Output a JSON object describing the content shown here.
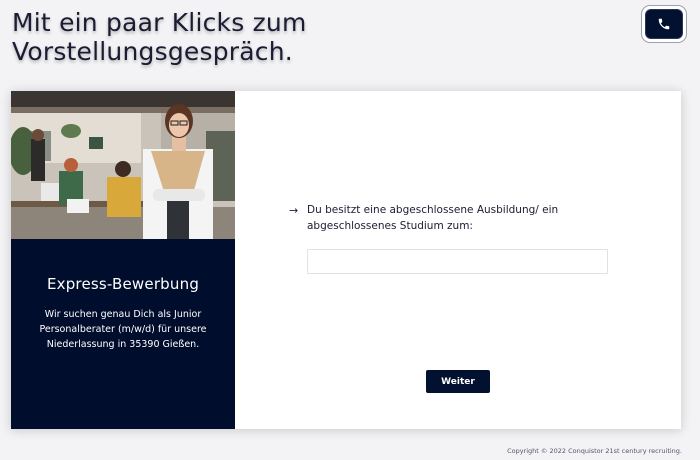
{
  "header": {
    "headline_line1": "Mit ein paar Klicks zum",
    "headline_line2": "Vorstellungsgespräch."
  },
  "contact": {
    "phone_icon": "phone-icon"
  },
  "job_panel": {
    "photo": "office-team-photo",
    "title": "Express-Bewerbung",
    "description": "Wir suchen genau Dich als Junior Personalberater (m/w/d) für unsere Niederlassung in 35390 Gießen."
  },
  "form": {
    "arrow_icon": "arrow-right-icon",
    "question": "Du besitzt eine abgeschlossene Ausbildung/ ein abgeschlossenes Studium zum:",
    "answer_value": "",
    "answer_placeholder": "",
    "next_label": "Weiter"
  },
  "footer": {
    "copyright": "Copyright © 2022 Conquistor 21st century recruiting."
  },
  "colors": {
    "brand_navy": "#000d2d",
    "button_navy": "#02112f",
    "page_background": "#f3f3f5",
    "text_dark": "#1b1c33"
  }
}
